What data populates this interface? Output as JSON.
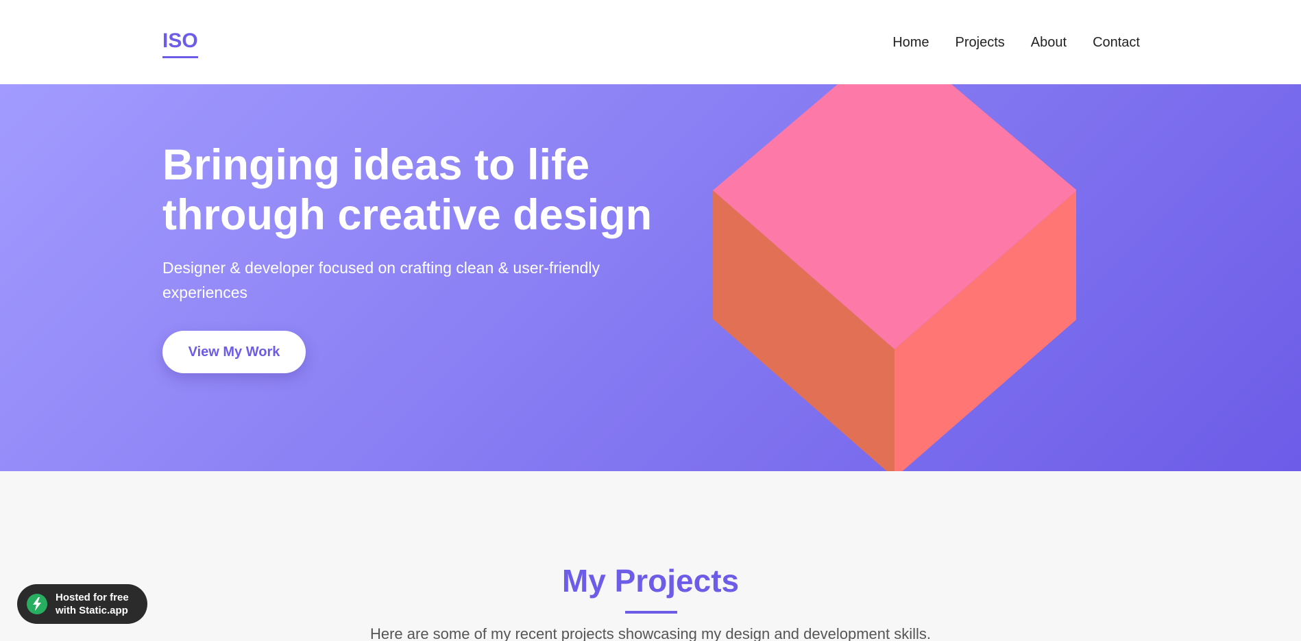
{
  "header": {
    "logo": "ISO",
    "nav": [
      "Home",
      "Projects",
      "About",
      "Contact"
    ]
  },
  "hero": {
    "title_line1": "Bringing ideas to life",
    "title_line2": "through creative design",
    "subtitle": "Designer & developer focused on crafting clean & user-friendly experiences",
    "cta_label": "View My Work",
    "gradient_start": "#a29bfe",
    "gradient_end": "#6c5ce7",
    "cube_colors": {
      "top": "#fd79a8",
      "left": "#e17055",
      "right": "#ff7675"
    }
  },
  "projects": {
    "title": "My Projects",
    "subtitle": "Here are some of my recent projects showcasing my design and development skills."
  },
  "badge": {
    "line1": "Hosted for free",
    "line2": "with Static.app",
    "icon": "lightning-icon"
  },
  "colors": {
    "accent": "#6c5ce7"
  }
}
